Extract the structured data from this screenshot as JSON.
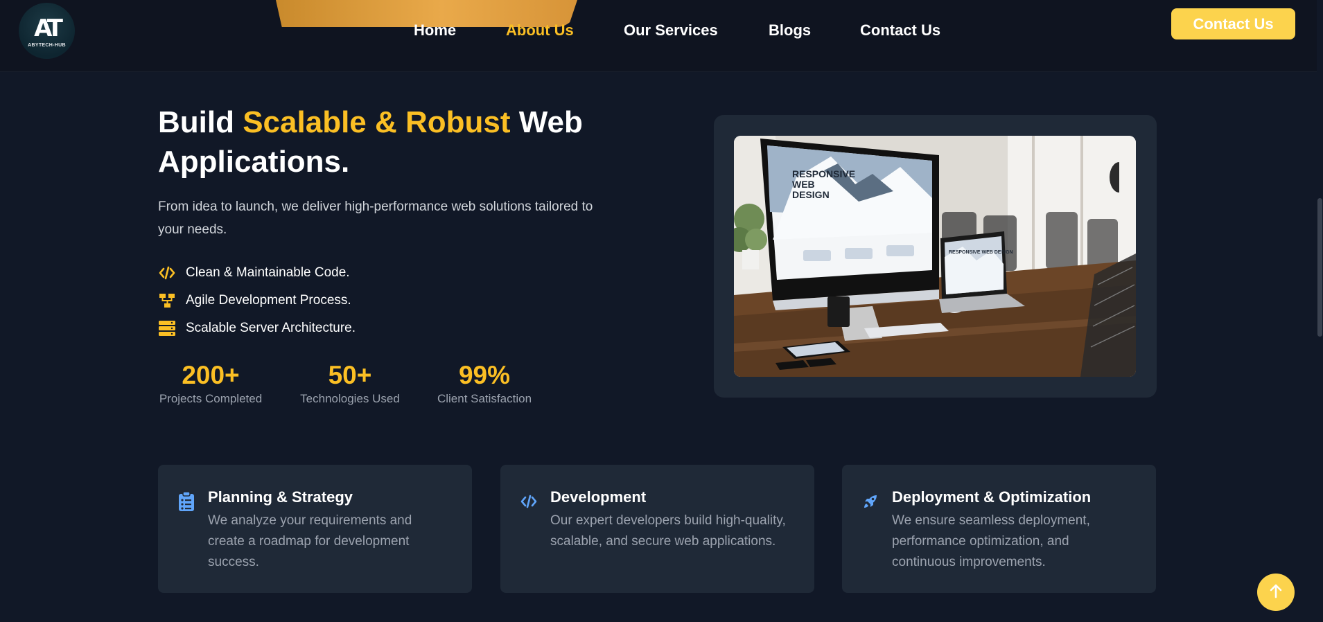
{
  "brand": {
    "logo_mark": "AT",
    "logo_text": "ABYTECH-HUB"
  },
  "nav": {
    "items": [
      {
        "label": "Home",
        "active": false
      },
      {
        "label": "About Us",
        "active": true
      },
      {
        "label": "Our Services",
        "active": false
      },
      {
        "label": "Blogs",
        "active": false
      },
      {
        "label": "Contact Us",
        "active": false
      }
    ],
    "cta_label": "Contact Us"
  },
  "hero": {
    "title_pre": "Build ",
    "title_highlight": "Scalable & Robust",
    "title_post": " Web Applications.",
    "subtitle": "From idea to launch, we deliver high-performance web solutions tailored to your needs.",
    "features": [
      {
        "icon": "code-icon",
        "label": "Clean & Maintainable Code."
      },
      {
        "icon": "sitemap-icon",
        "label": "Agile Development Process."
      },
      {
        "icon": "server-icon",
        "label": "Scalable Server Architecture."
      }
    ],
    "stats": [
      {
        "value": "200+",
        "label": "Projects Completed"
      },
      {
        "value": "50+",
        "label": "Technologies Used"
      },
      {
        "value": "99%",
        "label": "Client Satisfaction"
      }
    ],
    "image": {
      "screen_heading_1": "RESPONSIVE",
      "screen_heading_2": "WEB",
      "screen_heading_3": "DESIGN",
      "laptop_heading": "RESPONSIVE WEB DESIGN"
    }
  },
  "services": [
    {
      "icon": "clipboard-list-icon",
      "title": "Planning & Strategy",
      "description": "We analyze your requirements and create a roadmap for development success."
    },
    {
      "icon": "code-icon",
      "title": "Development",
      "description": "Our expert developers build high-quality, scalable, and secure web applications."
    },
    {
      "icon": "rocket-icon",
      "title": "Deployment & Optimization",
      "description": "We ensure seamless deployment, performance optimization, and continuous improvements."
    }
  ],
  "colors": {
    "background": "#111827",
    "header": "#0f1420",
    "card": "#1f2937",
    "accent": "#fbbf24",
    "button": "#fcd34d",
    "icon_blue": "#60a5fa",
    "muted_text": "#9ca3af"
  },
  "scroll_top_icon": "arrow-up-icon"
}
